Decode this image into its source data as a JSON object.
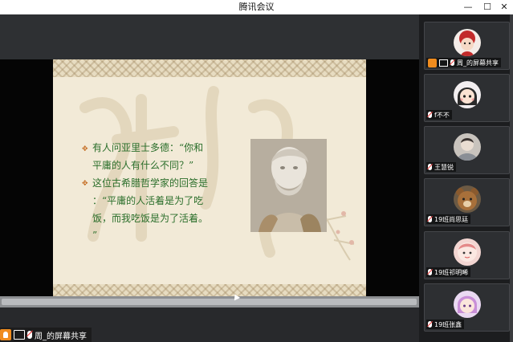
{
  "window": {
    "title": "腾讯会议",
    "min_icon": "minimize-icon",
    "max_icon": "maximize-icon",
    "close_icon": "close-icon"
  },
  "slide": {
    "bullet1_line1": "有人问亚里士多德：“你和",
    "bullet1_line2": "平庸的人有什么不同？”",
    "bullet2_line1": "这位古希腊哲学家的回答是",
    "bullet2_line2": "：“平庸的人活着是为了吃",
    "bullet2_line3": "饭，而我吃饭是为了活着。",
    "bullet2_line4": "”",
    "text_color": "#2a6e2a",
    "bullet_color": "#c46a1e"
  },
  "share_label": {
    "text": "周_的屏幕共享"
  },
  "participants": [
    {
      "name": "周_的屏幕共享",
      "host": true
    },
    {
      "name": "f不不"
    },
    {
      "name": "王慧锐"
    },
    {
      "name": "19班尚思廷"
    },
    {
      "name": "19班祁明晞"
    },
    {
      "name": "19班张鑫"
    }
  ],
  "colors": {
    "accent": "#f08c1e",
    "background": "#2b2d30"
  }
}
